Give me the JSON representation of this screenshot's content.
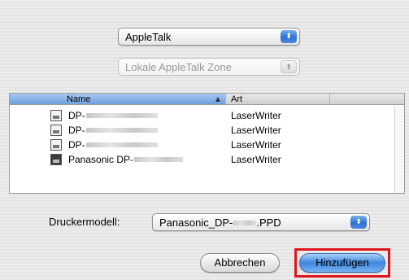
{
  "zone_type_popup": {
    "label": "AppleTalk",
    "arrows": "⬍"
  },
  "zone_popup": {
    "label": "Lokale AppleTalk Zone",
    "arrows": "⬍"
  },
  "table": {
    "columns": {
      "name": "Name",
      "sort": "▲",
      "art": "Art"
    },
    "rows": [
      {
        "name": "DP-",
        "art": "LaserWriter",
        "icon": "printer-icon"
      },
      {
        "name": "DP-",
        "art": "LaserWriter",
        "icon": "printer-icon"
      },
      {
        "name": "DP-",
        "art": "LaserWriter",
        "icon": "printer-icon"
      },
      {
        "name": "Panasonic DP-",
        "art": "LaserWriter",
        "icon": "printer-icon-selected"
      }
    ]
  },
  "driver": {
    "label": "Druckermodell:",
    "prefix": "Panasonic_DP-",
    "suffix": ".PPD",
    "arrows": "⬍"
  },
  "buttons": {
    "cancel": "Abbrechen",
    "add": "Hinzufügen"
  },
  "colors": {
    "highlight": "#e0141b",
    "accent": "#3f86df"
  }
}
